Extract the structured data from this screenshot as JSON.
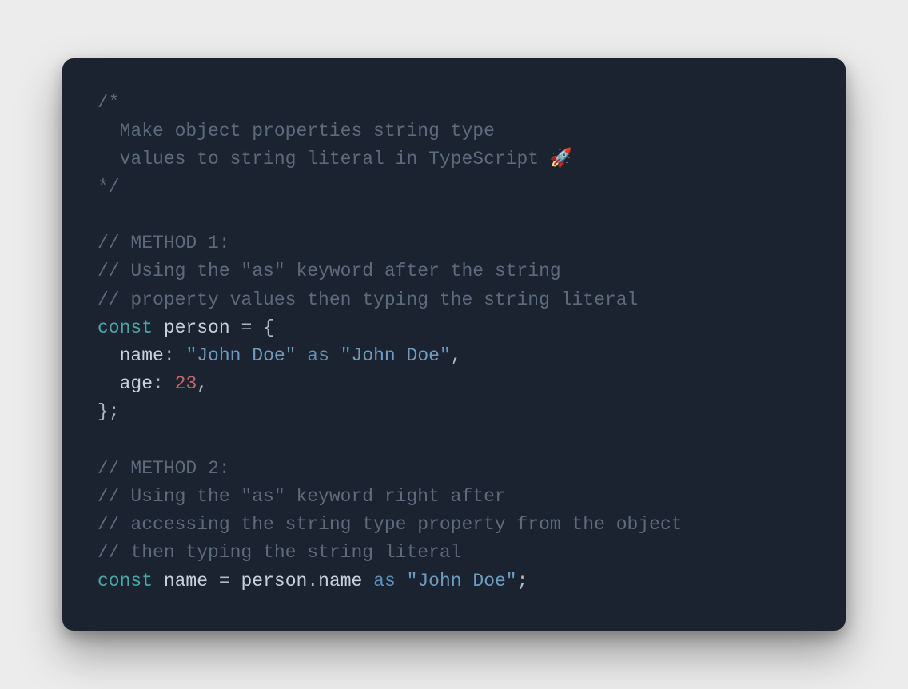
{
  "header": {
    "open": "/*",
    "line1": "  Make object properties string type",
    "line2": "  values to string literal in TypeScript 🚀",
    "close": "*/"
  },
  "method1": {
    "title": "// METHOD 1:",
    "desc1": "// Using the \"as\" keyword after the string",
    "desc2": "// property values then typing the string literal"
  },
  "kw": {
    "const": "const",
    "as": "as"
  },
  "obj": {
    "name": "person",
    "brace_open": "{",
    "prop_name": "name",
    "colon": ":",
    "john": "\"John Doe\"",
    "john_lit": "\"John Doe\"",
    "comma": ",",
    "prop_age": "age",
    "age_val": "23",
    "brace_close": "};"
  },
  "method2": {
    "title": "// METHOD 2:",
    "desc1": "// Using the \"as\" keyword right after",
    "desc2": "// accessing the string type property from the object",
    "desc3": "// then typing the string literal"
  },
  "line2": {
    "var": "name",
    "eq": "=",
    "expr_obj": "person",
    "dot": ".",
    "expr_prop": "name",
    "lit": "\"John Doe\"",
    "semi": ";"
  }
}
